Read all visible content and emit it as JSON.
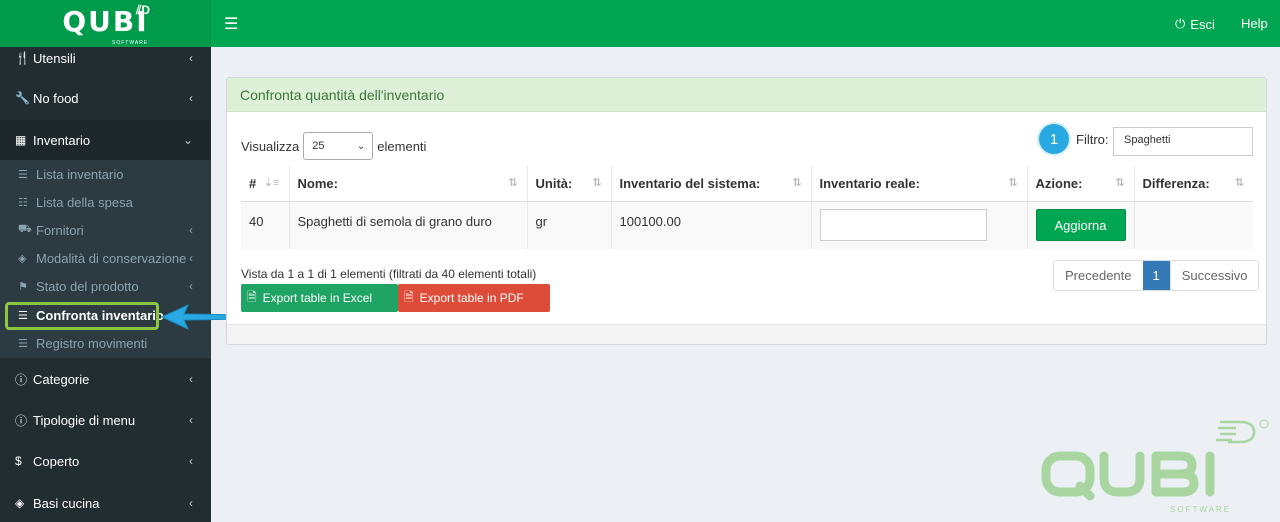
{
  "header": {
    "logo": "QUBI",
    "logo_sub": "SOFTWARE",
    "logout_label": "Esci",
    "help_label": "Help"
  },
  "sidebar": {
    "items": [
      {
        "label": "Utensili",
        "icon": "utensils-icon"
      },
      {
        "label": "No food",
        "icon": "wrench-icon"
      },
      {
        "label": "Inventario",
        "icon": "table-icon"
      },
      {
        "label": "Categorie",
        "icon": "info-icon"
      },
      {
        "label": "Tipologie di menu",
        "icon": "info-icon"
      },
      {
        "label": "Coperto",
        "icon": "dollar-icon"
      },
      {
        "label": "Basi cucina",
        "icon": "cube-icon"
      }
    ],
    "submenu": [
      {
        "label": "Lista inventario",
        "icon": "list-icon"
      },
      {
        "label": "Lista della spesa",
        "icon": "list-ol-icon"
      },
      {
        "label": "Fornitori",
        "icon": "truck-icon"
      },
      {
        "label": "Modalità di conservazione",
        "icon": "cube-icon"
      },
      {
        "label": "Stato del prodotto",
        "icon": "flag-icon"
      },
      {
        "label": "Confronta inventario",
        "icon": "bars-icon"
      },
      {
        "label": "Registro movimenti",
        "icon": "bars-icon"
      }
    ]
  },
  "box": {
    "title": "Confronta quantità dell'inventario",
    "show_label": "Visualizza",
    "show_value": "25",
    "show_suffix": "elementi",
    "step_badge": "1",
    "filter_label": "Filtro:",
    "filter_value": "Spaghetti",
    "columns": [
      "#",
      "Nome:",
      "Unità:",
      "Inventario del sistema:",
      "Inventario reale:",
      "Azione:",
      "Differenza:"
    ],
    "rows": [
      {
        "id": "40",
        "name": "Spaghetti di semola di grano duro",
        "unit": "gr",
        "system": "100100.00",
        "action": "Aggiorna",
        "diff": ""
      }
    ],
    "info": "Vista da 1 a 1 di 1 elementi (filtrati da 40 elementi totali)",
    "export_excel": "Export table in Excel",
    "export_pdf": "Export table in PDF",
    "pager": {
      "prev": "Precedente",
      "current": "1",
      "next": "Successivo"
    }
  },
  "colors": {
    "brand": "#00a651",
    "sidebar": "#222d32",
    "highlight": "#8dc63f",
    "badge": "#29a9e1"
  }
}
